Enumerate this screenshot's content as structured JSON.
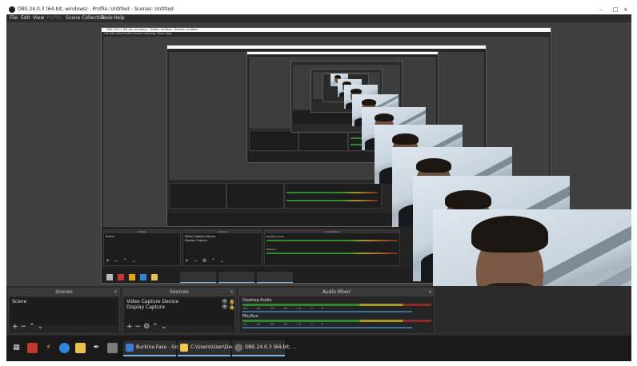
{
  "window": {
    "title": "OBS 24.0.3 (64-bit, windows) - Profile: Untitled - Scenes: Untitled",
    "minimize_icon": "minimize-icon",
    "maximize_icon": "maximize-icon",
    "close_icon": "close-icon"
  },
  "menu": [
    "File",
    "Edit",
    "View",
    "Profile",
    "Scene Collection",
    "Tools",
    "Help"
  ],
  "nested": {
    "title": "OBS 24.0.3 (64-bit, windows) - Profile: Untitled - Scenes: Untitled",
    "menu": "File  Edit  View  Profile  Scene Collection  Tools  Help"
  },
  "docks": {
    "scenes": {
      "header": "Scenes",
      "items": [
        "Scene"
      ]
    },
    "sources": {
      "header": "Sources",
      "items": [
        "Video Capture Device",
        "Display Capture"
      ]
    },
    "mixer": {
      "header": "Audio Mixer",
      "channels": [
        {
          "name": "Desktop Audio",
          "level": 0.9
        },
        {
          "name": "Mic/Aux",
          "level": 0.9
        }
      ]
    }
  },
  "taskbar": {
    "pinned_icons": [
      "windows-start-icon",
      "apps-icon",
      "lightning-icon",
      "edge-icon",
      "folder-icon",
      "pen-icon",
      "settings-icon"
    ],
    "windows": [
      {
        "label": "Burkina Faso - Goo...",
        "color": "#3b7bd9"
      },
      {
        "label": "C:\\Users\\User\\Doc...",
        "color": "#f2c94c"
      },
      {
        "label": "OBS 24.0.3 (64-bit, ...",
        "color": "#6b6b6b"
      }
    ]
  },
  "colors": {
    "background": "#2b2b2b",
    "preview": "#404040",
    "meter_green": "#2f8a2f",
    "meter_yellow": "#a69a2a",
    "meter_red": "#8a2a2a",
    "accent": "#7fb0e6"
  }
}
